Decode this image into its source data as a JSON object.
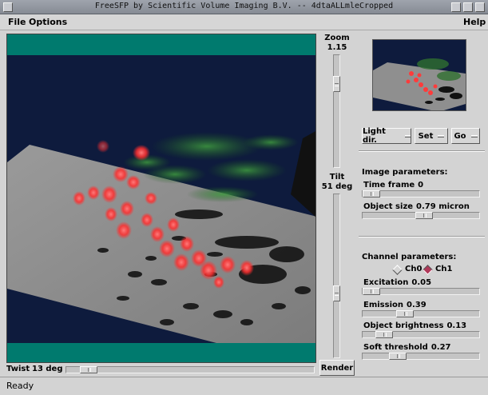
{
  "window": {
    "title": "FreeSFP by Scientific Volume Imaging B.V. -- 4dtaALLmleCropped"
  },
  "menu": {
    "file": "File",
    "options": "Options",
    "help": "Help"
  },
  "zoom": {
    "label": "Zoom",
    "value": "1.15",
    "level": 0.22
  },
  "tilt": {
    "label": "Tilt",
    "value": "51 deg",
    "level": 0.62
  },
  "twist": {
    "label": "Twist",
    "value": "13 deg",
    "level": 0.06
  },
  "render_button": "Render",
  "toolbar": {
    "light_dir": "Light dir.",
    "set": "Set",
    "go": "Go"
  },
  "image_params": {
    "heading": "Image parameters:",
    "time_frame": {
      "label": "Time frame",
      "value": "0",
      "level": 0.0
    },
    "object_size": {
      "label": "Object size",
      "value": "0.79 micron",
      "level": 0.53
    }
  },
  "channel_params": {
    "heading": "Channel parameters:",
    "channels": [
      {
        "label": "Ch0",
        "selected": false
      },
      {
        "label": "Ch1",
        "selected": true
      }
    ],
    "excitation": {
      "label": "Excitation",
      "value": "0.05",
      "level": 0.0
    },
    "emission": {
      "label": "Emission",
      "value": "0.39",
      "level": 0.34
    },
    "brightness": {
      "label": "Object brightness",
      "value": "0.13",
      "level": 0.13
    },
    "soft_threshold": {
      "label": "Soft threshold",
      "value": "0.27",
      "level": 0.27
    }
  },
  "status": "Ready",
  "colors": {
    "teal": "#007a6e",
    "navy": "#0e1b3d",
    "plane": "#8f8f8f",
    "red": "#ff3b3b",
    "green": "#2f7a2f"
  },
  "icons": {
    "window_menu": "window-menu-icon",
    "minimize": "minimize-icon",
    "maximize": "maximize-icon",
    "close": "close-icon"
  }
}
